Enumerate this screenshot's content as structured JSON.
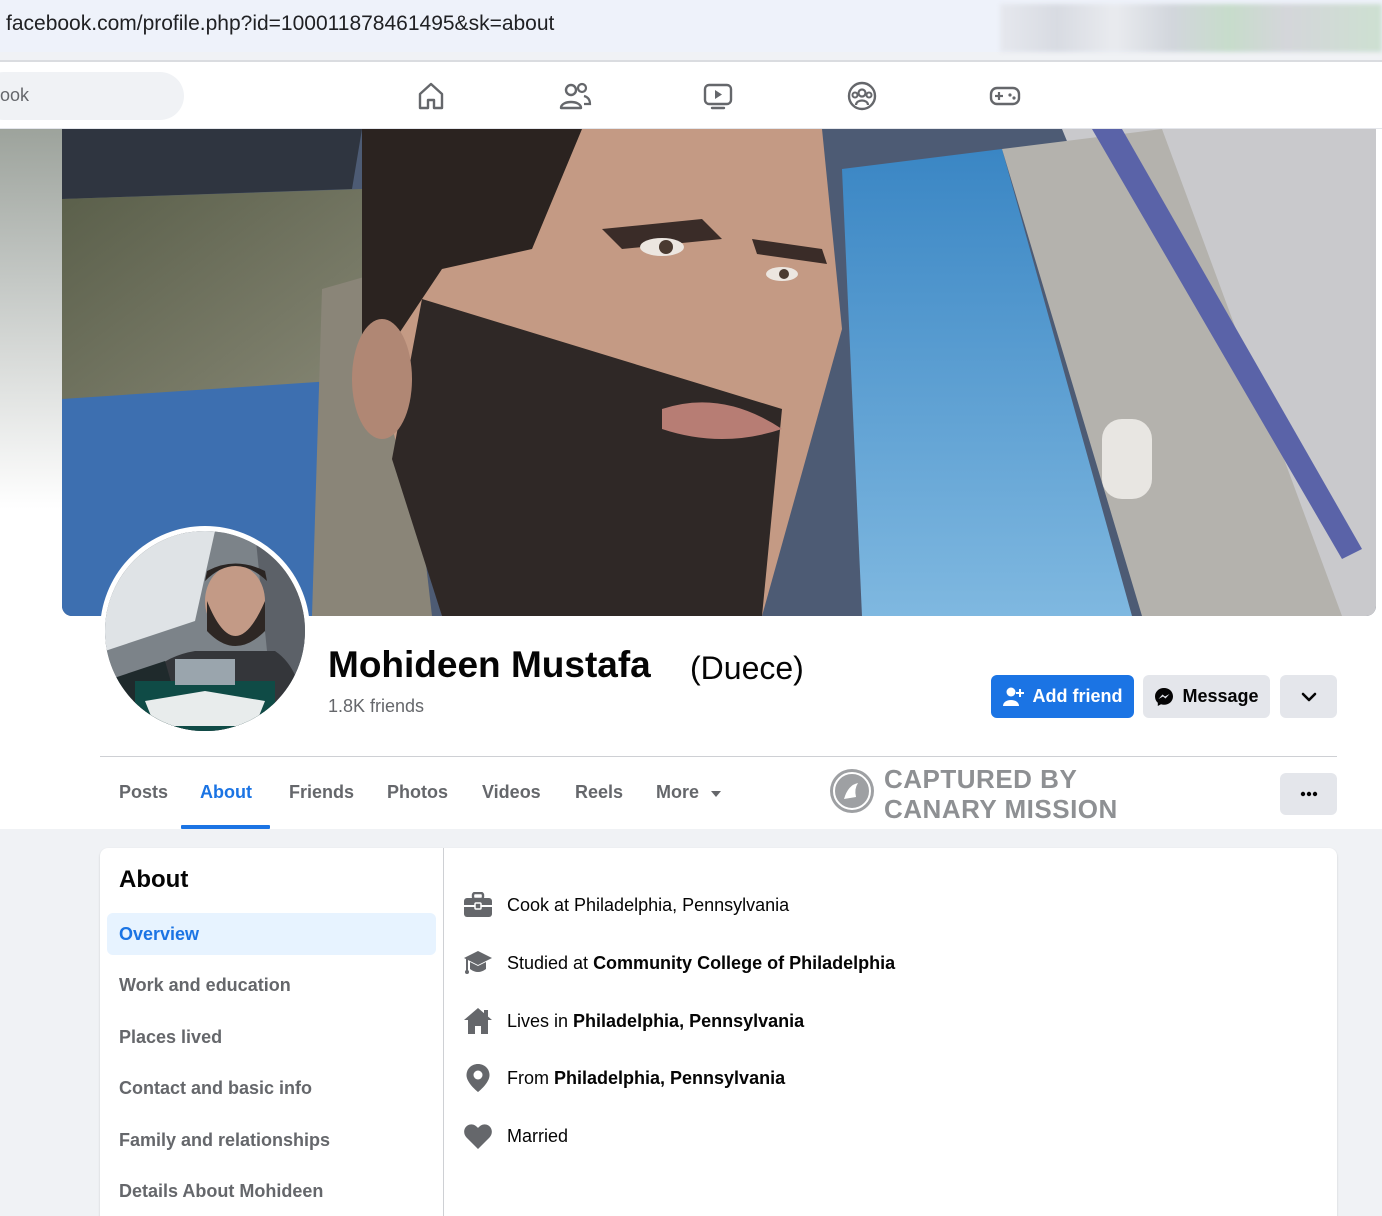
{
  "browser": {
    "url": "facebook.com/profile.php?id=100011878461495&sk=about"
  },
  "topbar": {
    "search_placeholder": "ook",
    "nav_icons": [
      "home-icon",
      "friends-icon",
      "watch-icon",
      "groups-icon",
      "gaming-icon"
    ]
  },
  "profile": {
    "name": "Mohideen Mustafa",
    "nickname": "(Duece)",
    "friends_count": "1.8K friends",
    "add_friend_label": "Add friend",
    "message_label": "Message"
  },
  "tabs": [
    {
      "label": "Posts",
      "active": false
    },
    {
      "label": "About",
      "active": true
    },
    {
      "label": "Friends",
      "active": false
    },
    {
      "label": "Photos",
      "active": false
    },
    {
      "label": "Videos",
      "active": false
    },
    {
      "label": "Reels",
      "active": false
    },
    {
      "label": "More",
      "active": false
    }
  ],
  "watermark": {
    "line1": "CAPTURED BY",
    "line2": "CANARY MISSION"
  },
  "about": {
    "title": "About",
    "menu": [
      {
        "label": "Overview",
        "active": true
      },
      {
        "label": "Work and education",
        "active": false
      },
      {
        "label": "Places lived",
        "active": false
      },
      {
        "label": "Contact and basic info",
        "active": false
      },
      {
        "label": "Family and relationships",
        "active": false
      },
      {
        "label": "Details About Mohideen",
        "active": false
      }
    ],
    "overview": [
      {
        "icon": "briefcase-icon",
        "prefix": "Cook at Philadelphia, Pennsylvania",
        "bold": ""
      },
      {
        "icon": "graduation-cap-icon",
        "prefix": "Studied at ",
        "bold": "Community College of Philadelphia"
      },
      {
        "icon": "house-icon",
        "prefix": "Lives in ",
        "bold": "Philadelphia, Pennsylvania"
      },
      {
        "icon": "location-pin-icon",
        "prefix": "From ",
        "bold": "Philadelphia, Pennsylvania"
      },
      {
        "icon": "heart-icon",
        "prefix": "Married",
        "bold": ""
      }
    ]
  },
  "colors": {
    "accent": "#1b74e4",
    "active_tab_bg": "#e7f3ff",
    "secondary_text": "#65676b",
    "page_bg": "#f0f2f5"
  }
}
